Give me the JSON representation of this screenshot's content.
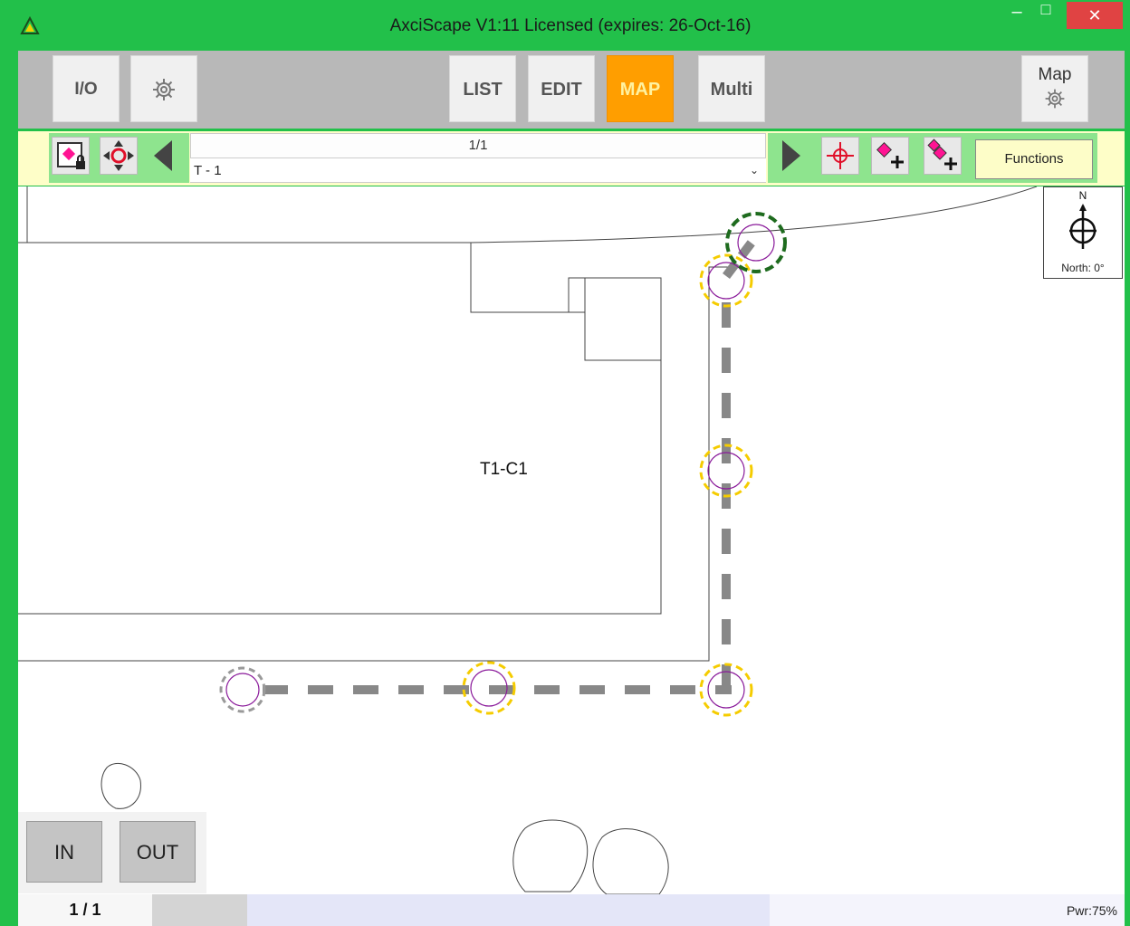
{
  "window": {
    "title": "AxciScape  V1:11   Licensed (expires: 26-Oct-16)",
    "minimize": "–",
    "maximize": "□",
    "close": "✕"
  },
  "toolbar": {
    "io_label": "I/O",
    "list_label": "LIST",
    "edit_label": "EDIT",
    "map_label": "MAP",
    "multi_label": "Multi",
    "map_settings_label": "Map",
    "active_tab": "MAP",
    "active_color": "#ff9e00"
  },
  "nav": {
    "record_counter": "1/1",
    "selected_record": "T - 1",
    "functions_label": "Functions"
  },
  "map": {
    "building_label": "T1-C1",
    "compass_north": "N",
    "compass_heading": "North: 0°",
    "route_color": "#888888",
    "point_ring_color": "#f5cc00",
    "start_ring_color": "#1e6b1e",
    "end_ring_color": "#999999"
  },
  "zoom": {
    "in_label": "IN",
    "out_label": "OUT"
  },
  "status": {
    "page": "1 / 1",
    "power": "Pwr:75%"
  },
  "icons": [
    "app-logo-icon",
    "gear-icon",
    "map-lock-icon",
    "move-icon",
    "prev-icon",
    "next-icon",
    "crosshair-icon",
    "add-point-icon",
    "add-points-icon",
    "compass-icon"
  ]
}
